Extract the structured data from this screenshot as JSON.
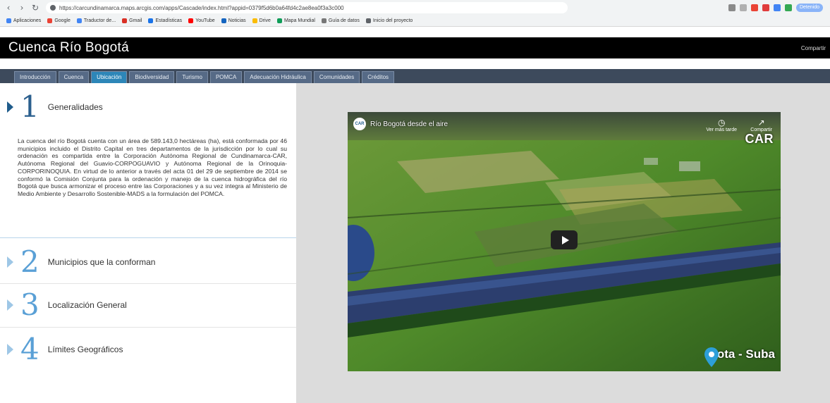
{
  "browser": {
    "url": "https://carcundinamarca.maps.arcgis.com/apps/Cascade/index.html?appid=0379f5d6b0a64fd4c2ae8ea0f3a3c000",
    "profile_label": "Detenido",
    "bookmarks": [
      "Aplicaciones",
      "Google",
      "Traductor de...",
      "Gmail",
      "Estadísticas",
      "YouTube",
      "Noticias",
      "Drive",
      "Mapa Mundial",
      "Guía de datos",
      "Inicio del proyecto"
    ]
  },
  "site": {
    "title": "Cuenca Río Bogotá",
    "header_right": "Compartir"
  },
  "tabs": [
    {
      "label": "Introducción",
      "active": false
    },
    {
      "label": "Cuenca",
      "active": false
    },
    {
      "label": "Ubicación",
      "active": true
    },
    {
      "label": "Biodiversidad",
      "active": false
    },
    {
      "label": "Turismo",
      "active": false
    },
    {
      "label": "POMCA",
      "active": false
    },
    {
      "label": "Adecuación Hidráulica",
      "active": false
    },
    {
      "label": "Comunidades",
      "active": false
    },
    {
      "label": "Créditos",
      "active": false
    }
  ],
  "sections": [
    {
      "number": "1",
      "title": "Generalidades"
    },
    {
      "number": "2",
      "title": "Municipios que la conforman"
    },
    {
      "number": "3",
      "title": "Localización General"
    },
    {
      "number": "4",
      "title": "Límites Geográficos"
    }
  ],
  "description": "La cuenca del río Bogotá cuenta con un área de 589.143,0 hectáreas (ha), está conformada por 46 municipios incluido el Distrito Capital en tres departamentos de la jurisdicción por lo cual su ordenación es compartida entre la Corporación Autónoma Regional de Cundinamarca-CAR, Autónoma Regional del Guavio-CORPOGUAVIO y Autónoma Regional de la Orinoquia-CORPORINOQUIA. En virtud de lo anterior a través del acta 01 del 29 de septiembre de 2014 se conformó la Comisión Conjunta para la ordenación y manejo de la cuenca hidrográfica del río Bogotá que busca armonizar el proceso entre las Corporaciones y a su vez integra al Ministerio de Medio Ambiente y Desarrollo Sostenible-MADS a la formulación del POMCA.",
  "video": {
    "title": "Río Bogotá desde el aire",
    "channel_badge": "CAR",
    "watch_later": "Ver más tarde",
    "share": "Compartir",
    "brand": "CAR",
    "location_label": "Cota - Suba"
  },
  "colors": {
    "header_bg": "#000000",
    "tabbar_bg": "#3d4a5c",
    "tab_active": "#2d86b8",
    "section_blue": "#2b5f8e",
    "right_bg": "#dcdcdc"
  }
}
